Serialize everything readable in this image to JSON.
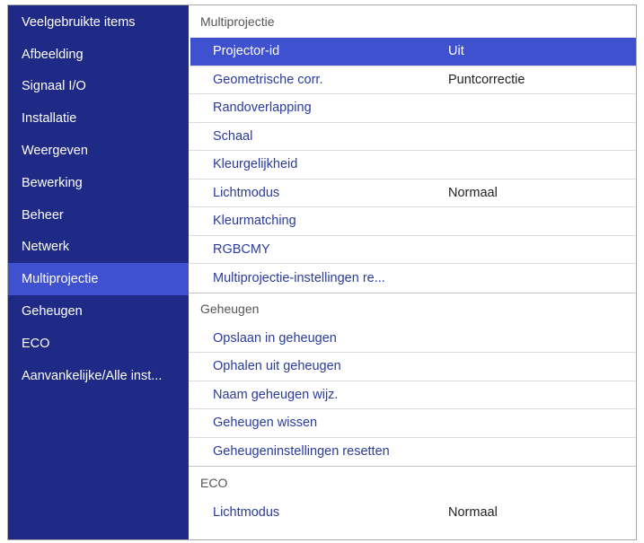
{
  "sidebar": {
    "items": [
      {
        "label": "Veelgebruikte items"
      },
      {
        "label": "Afbeelding"
      },
      {
        "label": "Signaal I/O"
      },
      {
        "label": "Installatie"
      },
      {
        "label": "Weergeven"
      },
      {
        "label": "Bewerking"
      },
      {
        "label": "Beheer"
      },
      {
        "label": "Netwerk"
      },
      {
        "label": "Multiprojectie",
        "selected": true
      },
      {
        "label": "Geheugen"
      },
      {
        "label": "ECO"
      },
      {
        "label": "Aanvankelijke/Alle inst..."
      }
    ]
  },
  "main": {
    "multiprojectie": {
      "header": "Multiprojectie",
      "rows": [
        {
          "label": "Projector-id",
          "value": "Uit",
          "selected": true
        },
        {
          "label": "Geometrische corr.",
          "value": "Puntcorrectie"
        },
        {
          "label": "Randoverlapping",
          "value": ""
        },
        {
          "label": "Schaal",
          "value": ""
        },
        {
          "label": "Kleurgelijkheid",
          "value": ""
        },
        {
          "label": "Lichtmodus",
          "value": "Normaal"
        },
        {
          "label": "Kleurmatching",
          "value": ""
        },
        {
          "label": "RGBCMY",
          "value": ""
        },
        {
          "label": "Multiprojectie-instellingen re...",
          "value": ""
        }
      ]
    },
    "geheugen": {
      "header": "Geheugen",
      "rows": [
        {
          "label": "Opslaan in geheugen"
        },
        {
          "label": "Ophalen uit geheugen"
        },
        {
          "label": "Naam geheugen wijz."
        },
        {
          "label": "Geheugen wissen"
        },
        {
          "label": "Geheugeninstellingen resetten"
        }
      ]
    },
    "eco": {
      "header": "ECO",
      "rows": [
        {
          "label": "Lichtmodus",
          "value": "Normaal"
        }
      ]
    }
  },
  "colors": {
    "sidebar_bg": "#1f2a86",
    "selected_bg": "#3f51cf",
    "item_text": "#2b3b9c",
    "value_text": "#222222",
    "header_text": "#555555"
  }
}
